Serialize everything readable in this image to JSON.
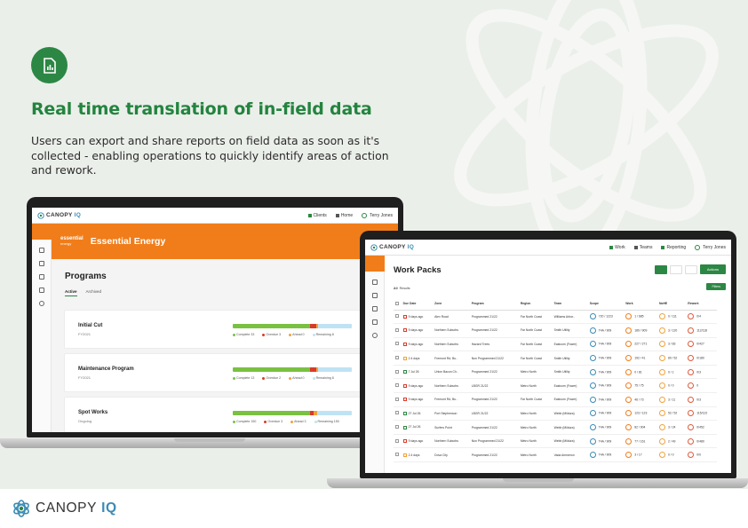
{
  "headline": "Real time translation of in-field data",
  "description": "Users can export and share reports on field data as soon as it's collected - enabling operations to quickly identify areas of action and rework.",
  "brand": {
    "name": "CANOPY",
    "suffix": "IQ",
    "green": "#2c8744",
    "blue": "#3b8bb5",
    "orange": "#f07d1a"
  },
  "badge_icon": "report-icon",
  "laptop1": {
    "top": {
      "clients": "Clients",
      "home": "Home",
      "user": "Terry Jones"
    },
    "org": {
      "logo_line1": "essential",
      "logo_line2": "energy",
      "title": "Essential Energy"
    },
    "page_title": "Programs",
    "tabs": {
      "active": "Active",
      "archived": "Archived"
    },
    "programs": [
      {
        "name": "Initial Cut",
        "sub": "FY2021",
        "complete": 0.65,
        "overdue": 0.05,
        "ahead": 0.02,
        "legend": [
          "Complete 33",
          "Overdue 3",
          "Ahead 0",
          "Remaining 8"
        ]
      },
      {
        "name": "Maintenance Program",
        "sub": "FY2021",
        "complete": 0.65,
        "overdue": 0.05,
        "ahead": 0.02,
        "legend": [
          "Complete 13",
          "Overdue 2",
          "Ahead 0",
          "Remaining 8"
        ]
      },
      {
        "name": "Spot Works",
        "sub": "Ongoing",
        "complete": 0.65,
        "overdue": 0.03,
        "ahead": 0.03,
        "legend": [
          "Complete 150",
          "Overdue 3",
          "Ahead 3",
          "Remaining 150"
        ]
      }
    ]
  },
  "laptop2": {
    "top": {
      "work": "Work",
      "teams": "Teams",
      "reporting": "Reporting",
      "user": "Terry Jones"
    },
    "page_title": "Work Packs",
    "actions": "Actions",
    "filters": "Filters",
    "results": "Results",
    "columns": [
      "Due Date",
      "Zone",
      "Program",
      "Region",
      "Team",
      "Scope",
      "Work",
      "NoHE",
      "Rework"
    ],
    "rows": [
      {
        "due": "9 days ago",
        "zone": "Alex Road",
        "program": "Programmed 21/22",
        "region": "Far North Coast",
        "team": "Williams Arbor..",
        "scope": "720 / 1223",
        "work": "1 / 685",
        "nohe": "0 / 111",
        "rework": "0/4"
      },
      {
        "due": "9 days ago",
        "zone": "Northern Suburbs",
        "program": "Programmed 21/22",
        "region": "Far North Coast",
        "team": "Smith Utility",
        "scope": "T4A / 909",
        "work": "189 / 909",
        "nohe": "3 / 120",
        "rework": "112/118"
      },
      {
        "due": "9 days ago",
        "zone": "Northern Suburbs",
        "program": "Hazard Trees",
        "region": "Far North Coast",
        "team": "Eastcom (Fower)",
        "scope": "T4A / 909",
        "work": "227 / 271",
        "nohe": "3 / 83",
        "rework": "0/427"
      },
      {
        "due": "2.4 days",
        "zone": "Fremont Rd, Bu..",
        "program": "Non Programmed 21/22",
        "region": "Far North Coast",
        "team": "Smith Utility",
        "scope": "T4A / 909",
        "work": "192 / 41",
        "nohe": "80 / 52",
        "rework": "0/180"
      },
      {
        "due": "7 Jul 26",
        "zone": "Union Bacon Ch..",
        "program": "Programmed 21/22",
        "region": "Metro North",
        "team": "Smith Utility",
        "scope": "T4A / 909",
        "work": "0 / 81",
        "nohe": "0 / 1",
        "rework": "0/3"
      },
      {
        "due": "9 days ago",
        "zone": "Northern Suburbs",
        "program": "LBGR 21/22",
        "region": "Metro North",
        "team": "Eastcom (Fower)",
        "scope": "T4A / 909",
        "work": "75 / 75",
        "nohe": "0 / 0",
        "rework": "0"
      },
      {
        "due": "9 days ago",
        "zone": "Fremont Rd, Bu..",
        "program": "Programmed 21/22",
        "region": "Far North Coast",
        "team": "Eastcom (Fower)",
        "scope": "T4A / 909",
        "work": "46 / 73",
        "nohe": "3 / 11",
        "rework": "0/3"
      },
      {
        "due": "27 Jul 26",
        "zone": "Port Stephenson",
        "program": "LBGR 21/22",
        "region": "Metro North",
        "team": "Webb (Mildura)",
        "scope": "T4A / 909",
        "work": "123 / 123",
        "nohe": "52 / 52",
        "rework": "115/122"
      },
      {
        "due": "27 Jul 26",
        "zone": "Surfers Point",
        "program": "Programmed 21/22",
        "region": "Metro North",
        "team": "Webb (Mildura)",
        "scope": "T4A / 909",
        "work": "82 / 904",
        "nohe": "3 / 24",
        "rework": "0/452"
      },
      {
        "due": "9 days ago",
        "zone": "Northern Suburbs",
        "program": "Non Programmed 21/22",
        "region": "Metro North",
        "team": "Webb (Mildura)",
        "scope": "T4A / 909",
        "work": "77 / 161",
        "nohe": "2 / 49",
        "rework": "0/480"
      },
      {
        "due": "2.4 days",
        "zone": "Dova City",
        "program": "Programmed 21/22",
        "region": "Metro North",
        "team": "Vada Ammeron",
        "scope": "T4A / 909",
        "work": "3 / 17",
        "nohe": "0 / 0",
        "rework": "0/0"
      }
    ]
  },
  "footer_logo": {
    "name": "CANOPY",
    "suffix": "IQ"
  }
}
